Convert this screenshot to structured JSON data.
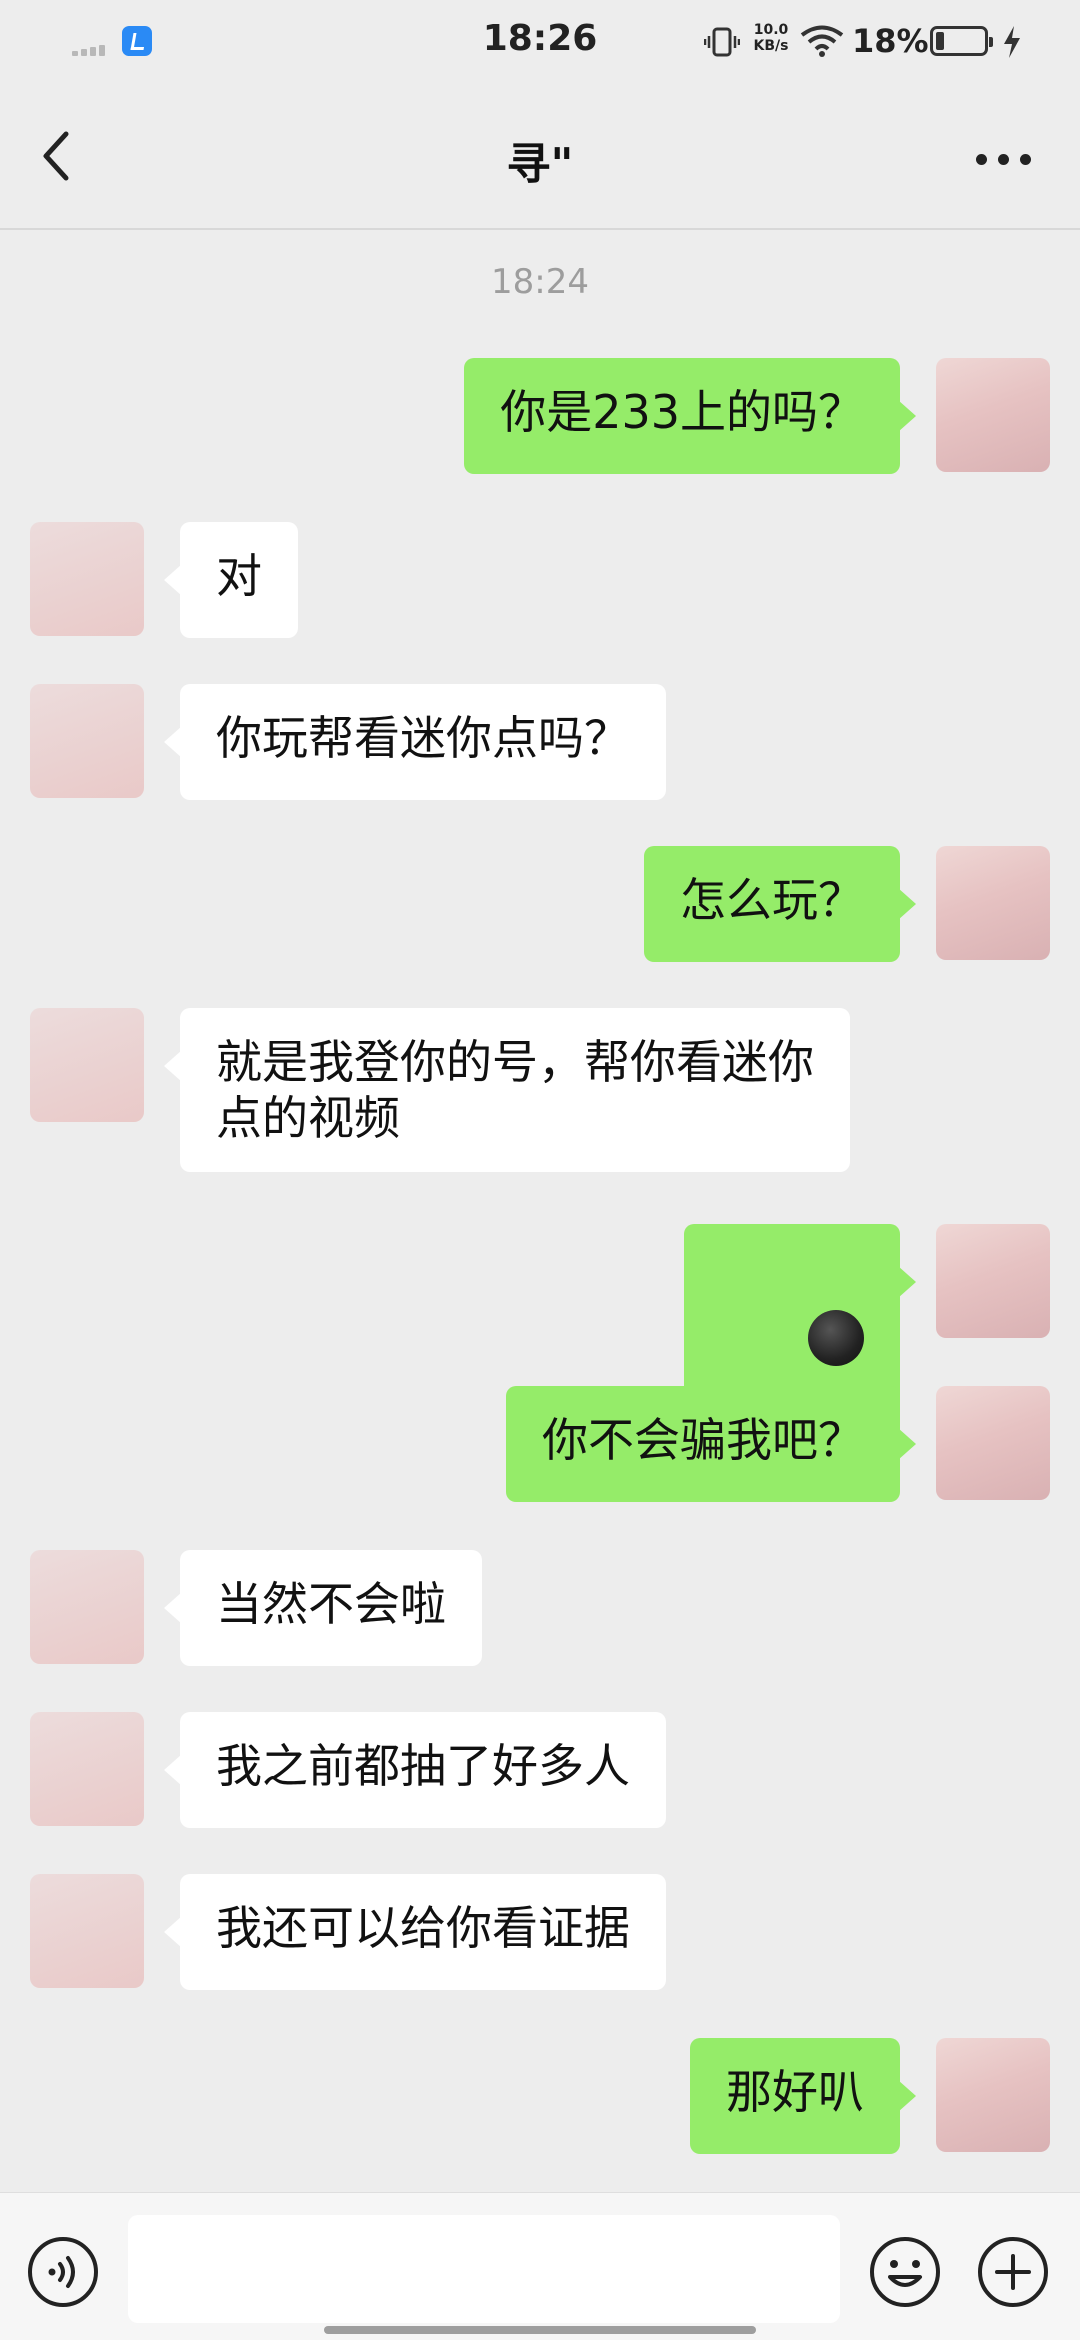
{
  "status_bar": {
    "time": "18:26",
    "net_speed_value": "10.0",
    "net_speed_unit": "KB/s",
    "battery_percent": "18%",
    "battery_level": 0.18
  },
  "header": {
    "title": "寻\"",
    "back_icon": "chevron-left-icon",
    "more_icon": "more-dots-icon"
  },
  "chat": {
    "timestamp": "18:24",
    "messages": [
      {
        "from": "me",
        "text": "你是233上的吗？"
      },
      {
        "from": "other",
        "text": "对"
      },
      {
        "from": "other",
        "text": "你玩帮看迷你点吗？"
      },
      {
        "from": "me",
        "text": "怎么玩？"
      },
      {
        "from": "other",
        "text": "就是我登你的号，帮你看迷你\n点的视频"
      },
      {
        "from": "me",
        "emoji": "smirk-face-emoji"
      },
      {
        "from": "me",
        "text": "你不会骗我吧？"
      },
      {
        "from": "other",
        "text": "当然不会啦"
      },
      {
        "from": "other",
        "text": "我之前都抽了好多人"
      },
      {
        "from": "other",
        "text": "我还可以给你看证据"
      },
      {
        "from": "me",
        "text": "那好叭"
      }
    ]
  },
  "input_bar": {
    "voice_icon": "voice-input-icon",
    "input_value": "",
    "emoji_icon": "emoji-icon",
    "plus_icon": "plus-icon"
  },
  "colors": {
    "background": "#ededed",
    "my_bubble": "#95ec69",
    "their_bubble": "#ffffff",
    "timestamp": "#9d9d9d"
  }
}
